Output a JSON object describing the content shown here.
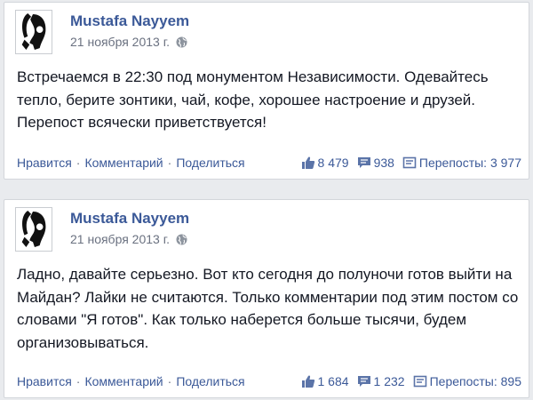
{
  "icons": {
    "avatar": "profile-avatar-icon",
    "privacy": "globe-icon",
    "like": "thumbs-up-icon",
    "comment": "comment-bubble-icon",
    "share": "share-icon"
  },
  "colors": {
    "author": "#3b5998",
    "link": "#3b5998",
    "meta": "#6a7180",
    "background": "#e9ebee"
  },
  "posts": [
    {
      "author": "Mustafa Nayyem",
      "date": "21 ноября 2013 г.",
      "text": "Встречаемся в 22:30 под монументом Независимости. Одевайтесь тепло, берите зонтики, чай, кофе, хорошее настроение и друзей. Перепост всячески приветствуется!",
      "actions": {
        "like": "Нравится",
        "comment": "Комментарий",
        "share": "Поделиться"
      },
      "separator": "·",
      "likes": "8 479",
      "comments": "938",
      "shares": "Перепосты: 3 977"
    },
    {
      "author": "Mustafa Nayyem",
      "date": "21 ноября 2013 г.",
      "text": "Ладно, давайте серьезно. Вот кто сегодня до полуночи готов выйти на Майдан? Лайки не считаются. Только комментарии под этим постом со словами \"Я готов\". Как только наберется больше тысячи, будем организовываться.",
      "actions": {
        "like": "Нравится",
        "comment": "Комментарий",
        "share": "Поделиться"
      },
      "separator": "·",
      "likes": "1 684",
      "comments": "1 232",
      "shares": "Перепосты: 895"
    }
  ]
}
